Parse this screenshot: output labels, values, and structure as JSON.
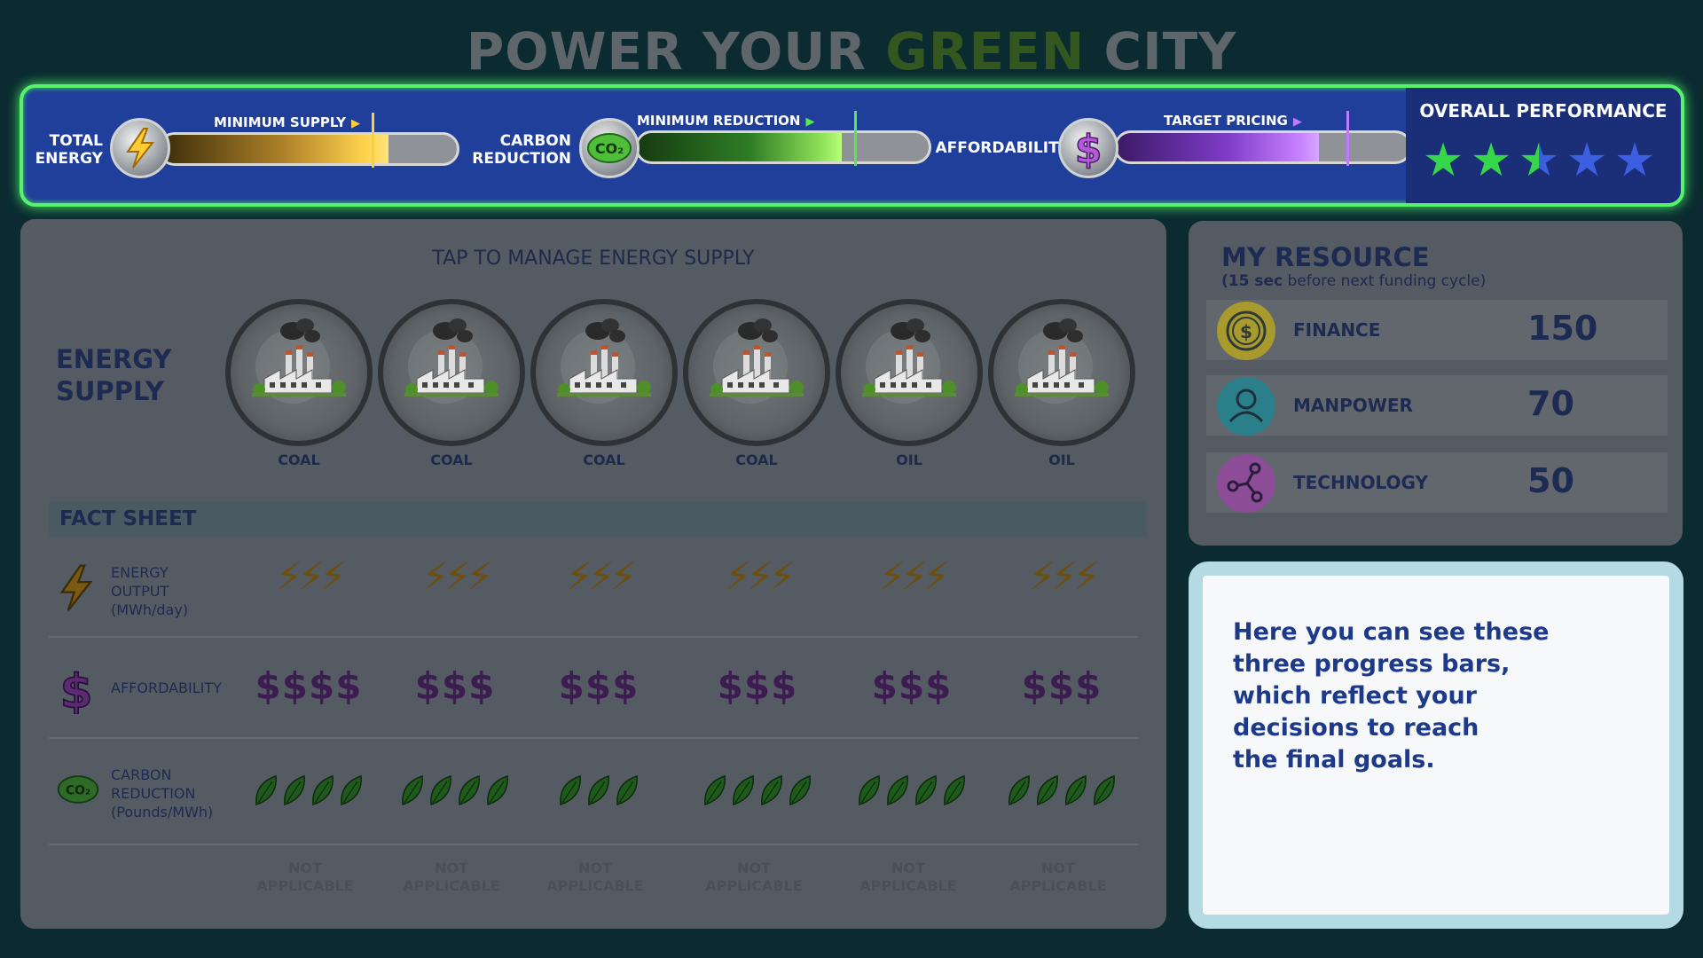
{
  "title": {
    "part1": "POWER YOUR",
    "part2": "GREEN",
    "part3": "CITY"
  },
  "metrics": {
    "energy": {
      "label_line1": "TOTAL",
      "label_line2": "ENERGY",
      "caption": "MINIMUM SUPPLY",
      "fill_fraction": 0.77,
      "target_fraction": 0.71,
      "icon": "lightning-bolt-icon"
    },
    "carbon": {
      "label_line1": "CARBON",
      "label_line2": "REDUCTION",
      "caption": "MINIMUM REDUCTION",
      "fill_fraction": 0.7,
      "target_fraction": 0.74,
      "icon": "co2-cloud-icon"
    },
    "afford": {
      "label": "AFFORDABILITY",
      "caption": "TARGET PRICING",
      "fill_fraction": 0.69,
      "target_fraction": 0.78,
      "icon": "dollar-icon"
    }
  },
  "performance": {
    "title": "OVERALL PERFORMANCE",
    "rating": 2.5,
    "max": 5
  },
  "energy_panel": {
    "tap_title": "TAP TO MANAGE ENERGY SUPPLY",
    "supply_line1": "ENERGY",
    "supply_line2": "SUPPLY",
    "plants": [
      {
        "type": "COAL"
      },
      {
        "type": "COAL"
      },
      {
        "type": "COAL"
      },
      {
        "type": "COAL"
      },
      {
        "type": "OIL"
      },
      {
        "type": "OIL"
      }
    ]
  },
  "fact_sheet": {
    "header": "FACT SHEET",
    "output_label": [
      "ENERGY",
      "OUTPUT",
      "(MWh/day)"
    ],
    "afford_label": "AFFORDABILITY",
    "carbon_label": [
      "CARBON",
      "REDUCTION",
      "(Pounds/MWh)"
    ],
    "output_bolts": [
      3,
      3,
      3,
      3,
      3,
      3
    ],
    "afford_dollars": [
      "$$$$",
      "$$$",
      "$$$",
      "$$$",
      "$$$",
      "$$$"
    ],
    "carbon_leaves": [
      4,
      4,
      3,
      4,
      4,
      4
    ],
    "na_line1": "NOT",
    "na_line2": "APPLICABLE"
  },
  "resources": {
    "title": "MY RESOURCE",
    "sub_bold": "(15 sec",
    "sub_rest": " before next funding cycle)",
    "items": [
      {
        "name": "FINANCE",
        "value": "150",
        "icon": "coin-icon",
        "color": "#c9b93a"
      },
      {
        "name": "MANPOWER",
        "value": "70",
        "icon": "person-icon",
        "color": "#2e9aa8"
      },
      {
        "name": "TECHNOLOGY",
        "value": "50",
        "icon": "network-icon",
        "color": "#a85ab4"
      }
    ]
  },
  "tip": {
    "line1": "Here you can see these",
    "line2": "three progress bars,",
    "line3": "which reflect your",
    "line4": "decisions to reach",
    "line5": "the final goals."
  },
  "colors": {
    "background": "#0b2b31",
    "panel_blue": "#1f3f9a",
    "glow_green": "#57f36b",
    "star_green": "#35d64a",
    "star_blue": "#3b5fe0",
    "text_navy": "#1d2a52"
  }
}
